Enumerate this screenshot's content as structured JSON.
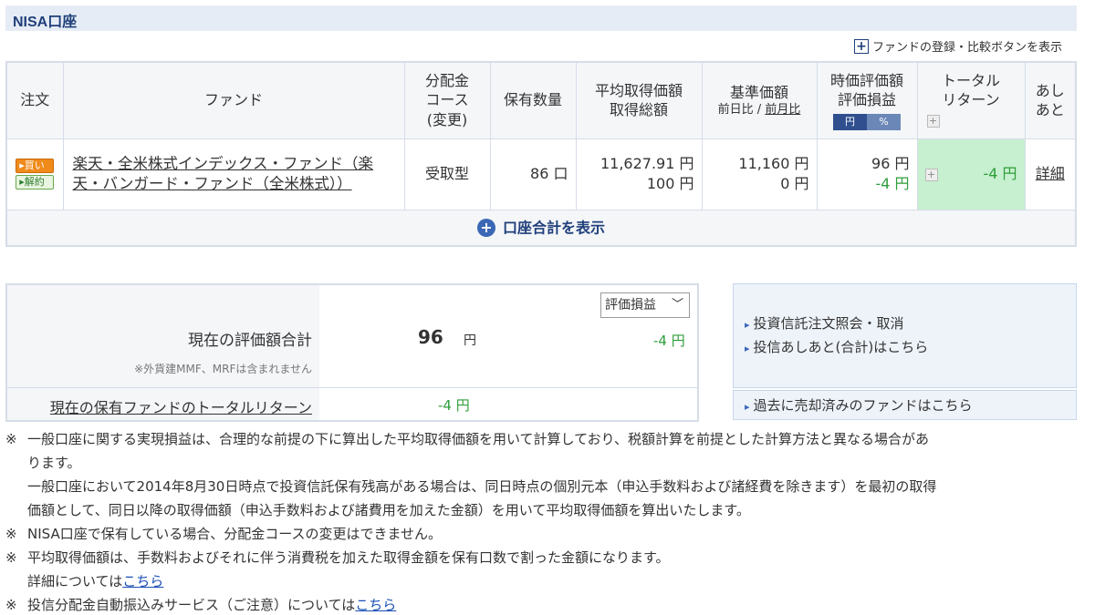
{
  "section_title": "NISA口座",
  "toggle_link": "ファンドの登録・比較ボタンを表示",
  "headers": {
    "order": "注文",
    "fund": "ファンド",
    "course_1": "分配金",
    "course_2": "コース",
    "course_3": "(変更)",
    "qty": "保有数量",
    "avg_1": "平均取得価額",
    "avg_2": "取得総額",
    "nav_1": "基準価額",
    "nav_prev_day": "前日比",
    "nav_sep": " / ",
    "nav_prev_month": "前月比",
    "mv_1": "時価評価額",
    "mv_2": "評価損益",
    "unit_yen": "円",
    "unit_pct": "%",
    "tr_1": "トータル",
    "tr_2": "リターン",
    "hist_1": "あし",
    "hist_2": "あと"
  },
  "row": {
    "buy": "買い",
    "sell": "解約",
    "fund_name": "楽天・全米株式インデックス・ファンド（楽天・バンガード・ファンド（全米株式））",
    "course": "受取型",
    "qty": "86 口",
    "avg_price": "11,627.91 円",
    "total_cost": "100 円",
    "nav": "11,160 円",
    "nav_change": "0 円",
    "market_value": "96 円",
    "pl": "-4 円",
    "total_return": "-4 円",
    "detail": "詳細"
  },
  "total_row": "口座合計を表示",
  "summary": {
    "title": "現在の評価額合計",
    "note": "※外貨建MMF、MRFは含まれません",
    "value": "96",
    "unit": "円",
    "select": "評価損益",
    "pl": "-4 円",
    "tr_label": "現在の保有ファンドのトータルリターン",
    "tr_value": "-4 円"
  },
  "links": {
    "order_inquiry": "投資信託注文照会・取消",
    "history": "投信あしあと(合計)はこちら",
    "past_sold": "過去に売却済みのファンドはこちら"
  },
  "notes": {
    "n1_a": "一般口座に関する実現損益は、合理的な前提の下に算出した平均取得価額を用いて計算しており、税額計算を前提とした計算方法と異なる場合があ",
    "n1_b": "ります。",
    "n1_c": "一般口座において2014年8月30日時点で投資信託保有残高がある場合は、同日時点の個別元本（申込手数料および諸経費を除きます）を最初の取得",
    "n1_d": "価額として、同日以降の取得価額（申込手数料および諸費用を加えた金額）を用いて平均取得価額を算出いたします。",
    "n2": "NISA口座で保有している場合、分配金コースの変更はできません。",
    "n3": "平均取得価額は、手数料およびそれに伴う消費税を加えた取得金額を保有口数で割った金額になります。",
    "n3_b": "詳細については",
    "n4": "投信分配金自動振込みサービス（ご注意）については",
    "link_here": "こちら",
    "mark": "※"
  },
  "colors": {
    "accent": "#1f3f7a",
    "profit_negative": "#2e9e3a",
    "total_return_bg": "#c6f0cf"
  }
}
